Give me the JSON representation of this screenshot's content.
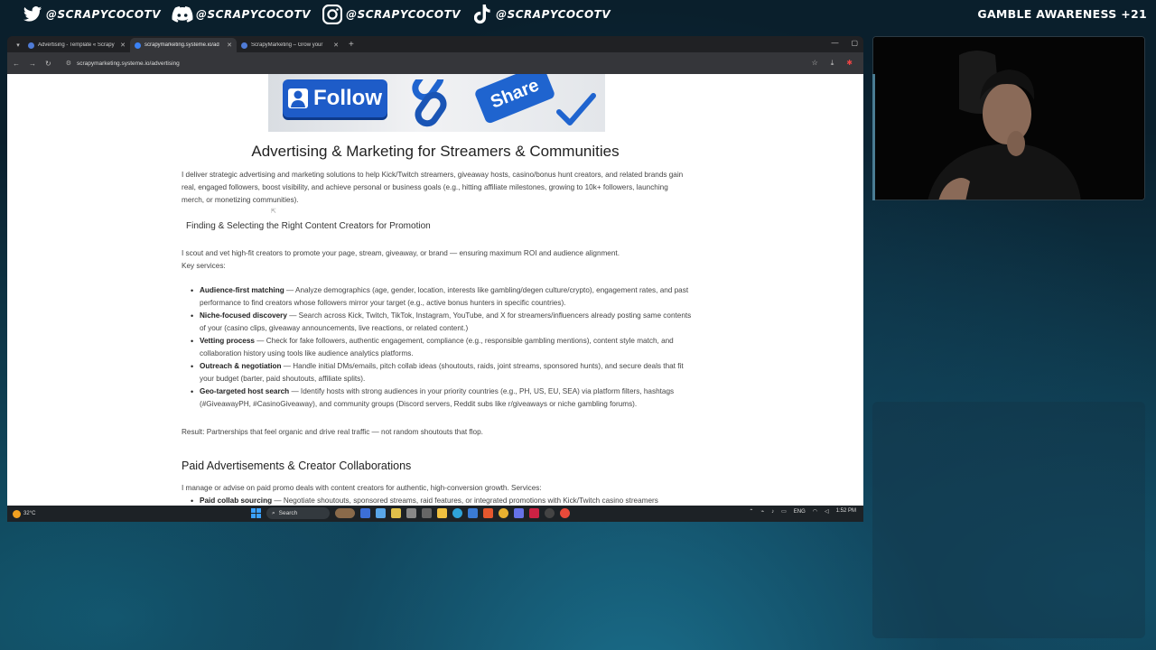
{
  "overlay": {
    "socials": [
      {
        "icon": "twitter-icon",
        "handle": "@SCRAPYCOCOTV"
      },
      {
        "icon": "discord-icon",
        "handle": "@SCRAPYCOCOTV"
      },
      {
        "icon": "instagram-icon",
        "handle": "@SCRAPYCOCOTV"
      },
      {
        "icon": "tiktok-icon",
        "handle": "@SCRAPYCOCOTV"
      }
    ],
    "gamble_notice": "GAMBLE AWARENESS +21"
  },
  "browser": {
    "tabs": [
      {
        "title": "Advertising - Template « Scrapy",
        "active": false,
        "favicon_color": "#4f7bd6"
      },
      {
        "title": "scrapymarketing.systeme.io/ad",
        "active": true,
        "favicon_color": "#3b82f6"
      },
      {
        "title": "ScrapyMarketing – Grow your",
        "active": false,
        "favicon_color": "#4f7bd6"
      }
    ],
    "url": "scrapymarketing.systeme.io/advertising"
  },
  "page": {
    "hero": {
      "follow_label": "Follow",
      "share_label": "Share"
    },
    "title": "Advertising & Marketing for Streamers & Communities",
    "intro": "I deliver strategic advertising and marketing solutions to help Kick/Twitch streamers, giveaway hosts, casino/bonus hunt creators, and related brands gain real, engaged followers, boost visibility, and achieve personal or business goals (e.g., hitting affiliate milestones, growing to 10k+ followers, launching merch, or monetizing communities).",
    "section1_title": "Finding & Selecting the Right Content Creators for Promotion",
    "section1_intro": "I scout and vet high-fit creators to promote your page, stream, giveaway, or brand — ensuring maximum ROI and audience alignment.",
    "key_services_label": "Key services:",
    "services": [
      {
        "title": "Audience-first matching",
        "desc": " — Analyze demographics (age, gender, location, interests like gambling/degen culture/crypto), engagement rates, and past performance to find creators whose followers mirror your target (e.g., active bonus hunters in specific countries)."
      },
      {
        "title": "Niche-focused discovery",
        "desc": " — Search across Kick, Twitch, TikTok, Instagram, YouTube, and X for streamers/influencers already posting same contents of your (casino clips, giveaway announcements, live reactions, or related content.)"
      },
      {
        "title": "Vetting process",
        "desc": " — Check for fake followers, authentic engagement, compliance (e.g., responsible gambling mentions), content style match, and collaboration history using tools like audience analytics platforms."
      },
      {
        "title": "Outreach & negotiation",
        "desc": " — Handle initial DMs/emails, pitch collab ideas (shoutouts, raids, joint streams, sponsored hunts), and secure deals that fit your budget (barter, paid shoutouts, affiliate splits)."
      },
      {
        "title": "Geo-targeted host search",
        "desc": " — Identify hosts with strong audiences in your priority countries (e.g., PH, US, EU, SEA) via platform filters, hashtags (#GiveawayPH, #CasinoGiveaway), and community groups (Discord servers, Reddit subs like r/giveaways or niche gambling forums)."
      }
    ],
    "result": "Result: Partnerships that feel organic and drive real traffic — not random shoutouts that flop.",
    "section2_title": "Paid Advertisements & Creator Collaborations",
    "section2_intro": "I manage or advise on paid promo deals with content creators for authentic, high-conversion growth. Services:",
    "section2_first_title": "Paid collab sourcing",
    "section2_first_desc": " — Negotiate shoutouts, sponsored streams, raid features, or integrated promotions with Kick/Twitch casino streamers"
  },
  "taskbar": {
    "temperature": "32°C",
    "search_label": "Search",
    "lang": "ENG",
    "time": "1:52 PM"
  }
}
